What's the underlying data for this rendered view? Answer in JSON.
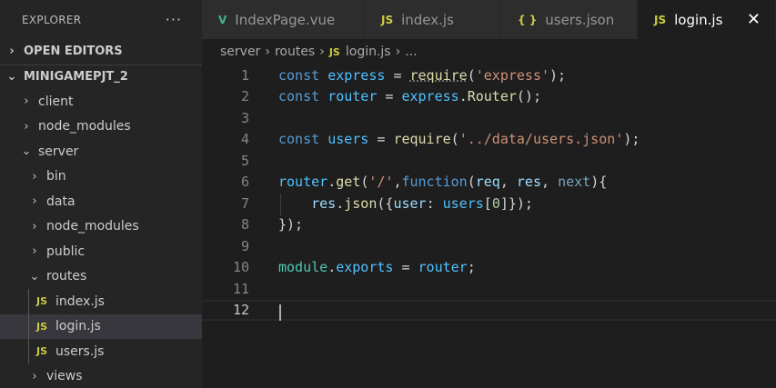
{
  "sidebar": {
    "title": "EXPLORER",
    "more": "···",
    "open_editors": "OPEN EDITORS",
    "project": "MINIGAMEPJT_2",
    "tree": [
      {
        "label": "client",
        "chev": "›"
      },
      {
        "label": "node_modules",
        "chev": "›"
      },
      {
        "label": "server",
        "chev": "⌄"
      },
      {
        "label": "bin",
        "chev": "›"
      },
      {
        "label": "data",
        "chev": "›"
      },
      {
        "label": "node_modules",
        "chev": "›"
      },
      {
        "label": "public",
        "chev": "›"
      },
      {
        "label": "routes",
        "chev": "⌄"
      },
      {
        "label": "index.js",
        "badge": "JS"
      },
      {
        "label": "login.js",
        "badge": "JS"
      },
      {
        "label": "users.js",
        "badge": "JS"
      },
      {
        "label": "views",
        "chev": "›"
      }
    ]
  },
  "tabs": [
    {
      "label": "IndexPage.vue",
      "icon": "V"
    },
    {
      "label": "index.js",
      "icon": "JS"
    },
    {
      "label": "users.json",
      "icon": "{ }"
    },
    {
      "label": "login.js",
      "icon": "JS",
      "close": "✕"
    }
  ],
  "breadcrumb": {
    "parts": [
      "server",
      "routes"
    ],
    "file_badge": "JS",
    "file": "login.js",
    "tail": "..."
  },
  "editor": {
    "line_numbers": [
      "1",
      "2",
      "3",
      "4",
      "5",
      "6",
      "7",
      "8",
      "9",
      "10",
      "11",
      "12"
    ],
    "current_line": 12
  },
  "colors": {
    "keyword": "#569cd6",
    "variable": "#4fc1ff",
    "function": "#dcdcaa",
    "string": "#ce9178",
    "number": "#b5cea8",
    "js_badge": "#cbcb41",
    "vue_icon": "#41b883"
  }
}
